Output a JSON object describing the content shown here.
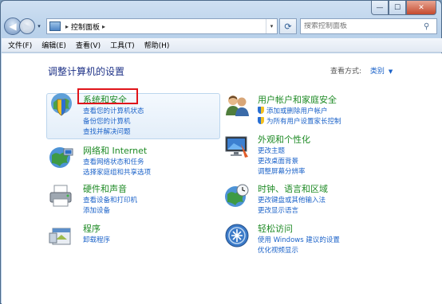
{
  "window": {
    "caption": {
      "minimize": "—",
      "maximize": "☐",
      "close": "✕"
    }
  },
  "nav": {
    "back_glyph": "◀",
    "forward_glyph": "▶",
    "address": {
      "breadcrumb": [
        "控制面板"
      ],
      "separator": "▸",
      "dropdown": "▾"
    },
    "refresh_glyph": "⟳",
    "search_placeholder": "搜索控制面板",
    "search_icon": "search-icon"
  },
  "menubar": {
    "items": [
      "文件(F)",
      "编辑(E)",
      "查看(V)",
      "工具(T)",
      "帮助(H)"
    ]
  },
  "content": {
    "title": "调整计算机的设置",
    "view_by": {
      "label": "查看方式:",
      "value": "类别",
      "arrow": "▼"
    },
    "categories": [
      {
        "title": "系统和安全",
        "icon": "shield-globe-icon",
        "links": [
          "查看您的计算机状态",
          "备份您的计算机",
          "查找并解决问题"
        ],
        "highlighted": true
      },
      {
        "title": "网络和 Internet",
        "icon": "network-globe-icon",
        "links": [
          "查看网络状态和任务",
          "选择家庭组和共享选项"
        ]
      },
      {
        "title": "硬件和声音",
        "icon": "printer-icon",
        "links": [
          "查看设备和打印机",
          "添加设备"
        ]
      },
      {
        "title": "程序",
        "icon": "programs-icon",
        "links": [
          "卸载程序"
        ]
      },
      {
        "title": "用户帐户和家庭安全",
        "icon": "users-icon",
        "links": [
          "添加或删除用户帐户",
          "为所有用户设置家长控制"
        ],
        "shield_links": true
      },
      {
        "title": "外观和个性化",
        "icon": "monitor-icon",
        "links": [
          "更改主题",
          "更改桌面背景",
          "调整屏幕分辨率"
        ]
      },
      {
        "title": "时钟、语言和区域",
        "icon": "clock-globe-icon",
        "links": [
          "更改键盘或其他输入法",
          "更改显示语言"
        ]
      },
      {
        "title": "轻松访问",
        "icon": "ease-of-access-icon",
        "links": [
          "使用 Windows 建议的设置",
          "优化视频显示"
        ]
      }
    ]
  },
  "colors": {
    "title_green": "#1d8a24",
    "link_blue": "#1c63c9",
    "page_title": "#1e3287",
    "highlight_red": "#e0141a"
  }
}
